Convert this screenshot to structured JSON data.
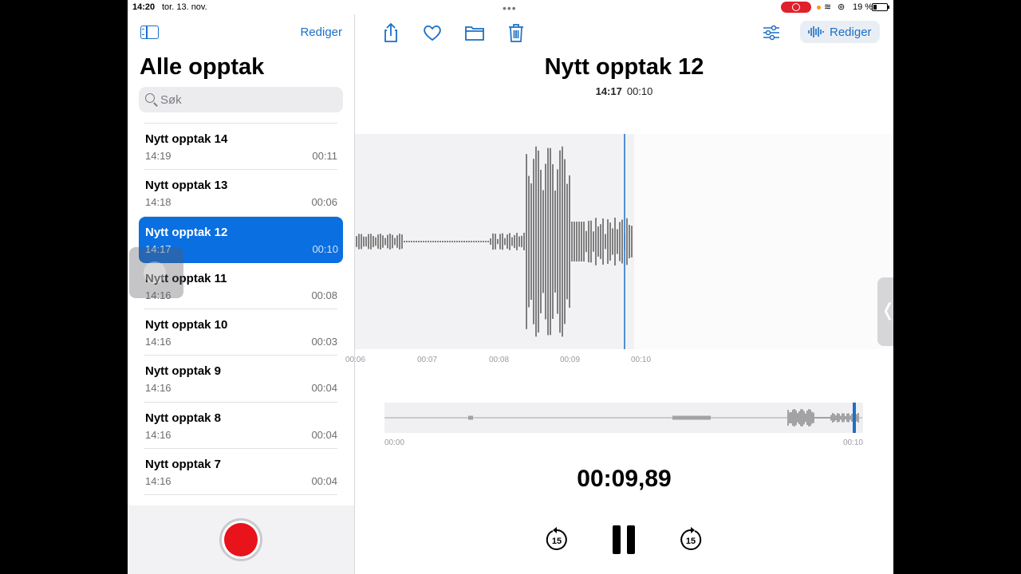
{
  "status_bar": {
    "time": "14:20",
    "date": "tor. 13. nov.",
    "battery_pct": "19 %"
  },
  "sidebar": {
    "edit_label": "Rediger",
    "title": "Alle opptak",
    "search_placeholder": "Søk",
    "items": [
      {
        "name": "Nytt opptak 14",
        "time": "14:19",
        "duration": "00:11"
      },
      {
        "name": "Nytt opptak 13",
        "time": "14:18",
        "duration": "00:06"
      },
      {
        "name": "Nytt opptak 12",
        "time": "14:17",
        "duration": "00:10",
        "selected": true
      },
      {
        "name": "Nytt opptak 11",
        "time": "14:16",
        "duration": "00:08"
      },
      {
        "name": "Nytt opptak 10",
        "time": "14:16",
        "duration": "00:03"
      },
      {
        "name": "Nytt opptak 9",
        "time": "14:16",
        "duration": "00:04"
      },
      {
        "name": "Nytt opptak 8",
        "time": "14:16",
        "duration": "00:04"
      },
      {
        "name": "Nytt opptak 7",
        "time": "14:16",
        "duration": "00:04"
      }
    ]
  },
  "toolbar": {
    "edit_label": "Rediger",
    "icons": [
      "share-icon",
      "heart-icon",
      "folder-icon",
      "trash-icon",
      "sliders-icon",
      "waveform-icon"
    ]
  },
  "recording": {
    "title": "Nytt opptak 12",
    "time": "14:17",
    "duration": "00:10",
    "ticks": [
      "00:06",
      "00:07",
      "00:08",
      "00:09",
      "00:10"
    ],
    "overview_start": "00:00",
    "overview_end": "00:10",
    "timer": "00:09,89",
    "playhead_progress": 0.99
  },
  "controls": {
    "skip_back_label": "15",
    "skip_forward_label": "15"
  },
  "colors": {
    "accent": "#1c6fc7",
    "selected": "#0a6fe0",
    "record": "#e8131b"
  }
}
